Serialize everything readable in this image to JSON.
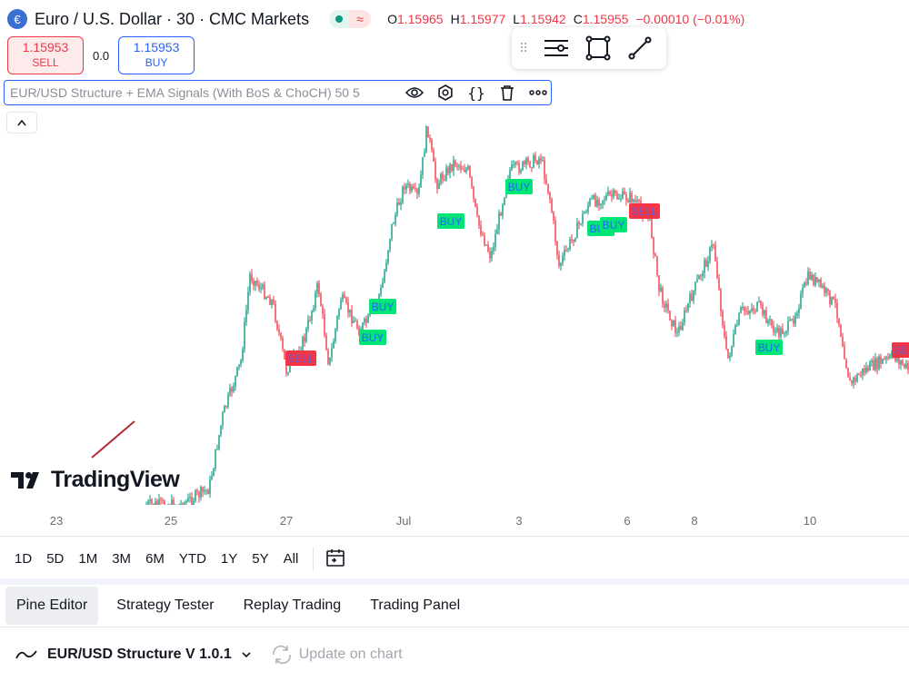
{
  "header": {
    "symbol_icon": "euro-flag-icon",
    "title": "Euro / U.S. Dollar · 30 · CMC Markets",
    "ohlc": {
      "o_key": "O",
      "o": "1.15965",
      "h_key": "H",
      "h": "1.15977",
      "l_key": "L",
      "l": "1.15942",
      "c_key": "C",
      "c": "1.15955",
      "change": "−0.00010 (−0.01%)"
    }
  },
  "trade": {
    "sell_price": "1.15953",
    "sell_label": "SELL",
    "spread": "0.0",
    "buy_price": "1.15953",
    "buy_label": "BUY"
  },
  "draw_toolbar": {
    "icons": [
      "grip-icon",
      "lines-icon",
      "rectangle-icon",
      "trendline-icon"
    ]
  },
  "indicator": {
    "name": "EUR/USD Structure + EMA Signals (With BoS & ChoCH) 50 5",
    "icons": [
      "eye-icon",
      "settings-icon",
      "source-code-icon",
      "delete-icon",
      "more-icon"
    ]
  },
  "chart": {
    "up_color": "#089981",
    "down_color": "#f23645",
    "buy_label": "BUY",
    "sell_label": "SELL"
  },
  "logo": {
    "text": "TradingView"
  },
  "time_axis": [
    "23",
    "25",
    "27",
    "Jul",
    "3",
    "6",
    "8",
    "10"
  ],
  "ranges": [
    "1D",
    "5D",
    "1M",
    "3M",
    "6M",
    "YTD",
    "1Y",
    "5Y",
    "All"
  ],
  "tabs": [
    "Pine Editor",
    "Strategy Tester",
    "Replay Trading",
    "Trading Panel"
  ],
  "script": {
    "name": "EUR/USD Structure V 1.0.1",
    "update_label": "Update on chart"
  }
}
